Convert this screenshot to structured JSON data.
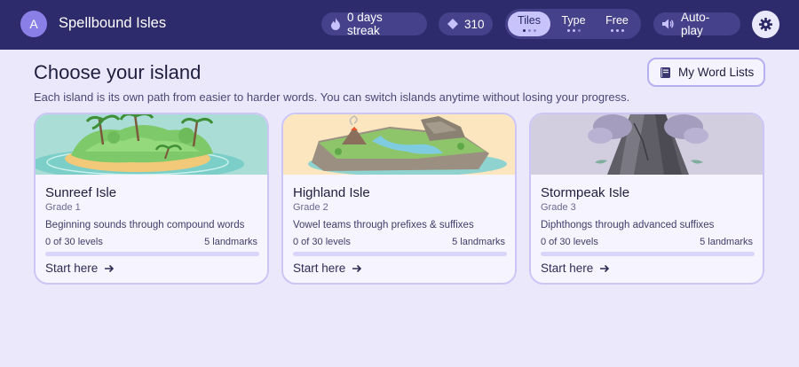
{
  "user": {
    "initial": "A"
  },
  "app": {
    "title": "Spellbound Isles"
  },
  "stats": {
    "streak_label": "0 days streak",
    "gems": "310"
  },
  "modes": [
    {
      "label": "Tiles",
      "active": true
    },
    {
      "label": "Type",
      "active": false
    },
    {
      "label": "Free",
      "active": false
    }
  ],
  "autoplay_label": "Auto-play",
  "page": {
    "title": "Choose your island",
    "subtitle": "Each island is its own path from easier to harder words. You can switch islands anytime without losing your progress.",
    "word_lists_label": "My Word Lists"
  },
  "islands": [
    {
      "name": "Sunreef Isle",
      "grade": "Grade 1",
      "description": "Beginning sounds through compound words",
      "progress": "0 of 30 levels",
      "progress_fraction": 0,
      "landmarks": "5 landmarks",
      "cta": "Start here"
    },
    {
      "name": "Highland Isle",
      "grade": "Grade 2",
      "description": "Vowel teams through prefixes & suffixes",
      "progress": "0 of 30 levels",
      "progress_fraction": 0,
      "landmarks": "5 landmarks",
      "cta": "Start here"
    },
    {
      "name": "Stormpeak Isle",
      "grade": "Grade 3",
      "description": "Diphthongs through advanced suffixes",
      "progress": "0 of 30 levels",
      "progress_fraction": 0,
      "landmarks": "5 landmarks",
      "cta": "Start here"
    }
  ],
  "colors": {
    "topbar": "#2e2b6d",
    "background": "#ebe8fc",
    "accent": "#8a7fe6",
    "active_mode": "#c9c3fb"
  },
  "icons": {
    "streak": "flame-icon",
    "gems": "gem-icon",
    "autoplay": "speaker-icon",
    "settings": "gear-icon",
    "word_lists": "book-icon",
    "start": "arrow-right-icon"
  }
}
